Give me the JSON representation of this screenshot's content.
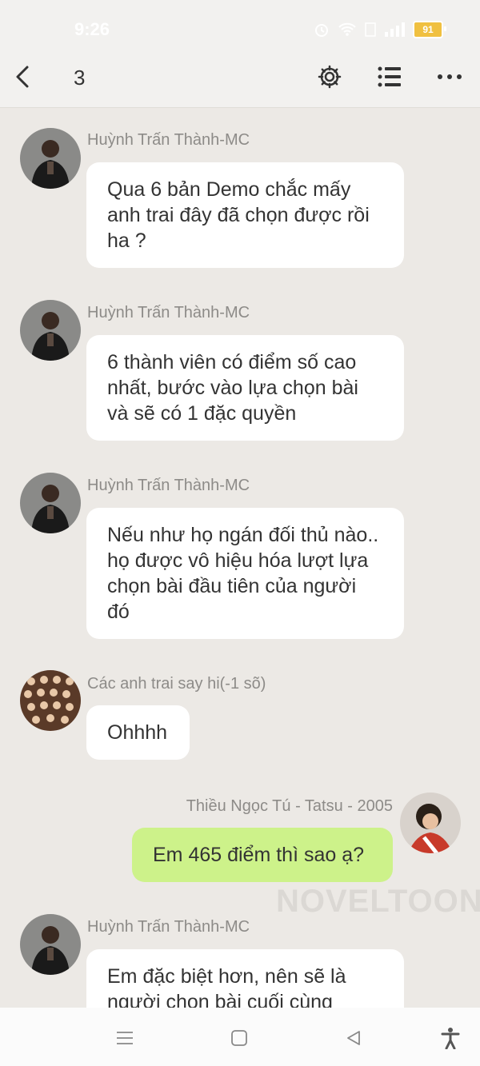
{
  "status_bar": {
    "time": "9:26",
    "battery": "91"
  },
  "header": {
    "title": "3"
  },
  "messages": [
    {
      "sender": "Huỳnh Trấn Thành-MC",
      "text": "Qua 6 bản Demo chắc mấy anh trai đây đã chọn được rồi ha ?"
    },
    {
      "sender": "Huỳnh Trấn Thành-MC",
      "text": "6 thành viên có điểm số cao nhất, bước vào lựa chọn bài và sẽ có 1 đặc quyền"
    },
    {
      "sender": "Huỳnh Trấn Thành-MC",
      "text": "Nếu như họ ngán đối thủ nào.. họ được vô hiệu hóa lượt lựa chọn bài đầu tiên của người đó"
    },
    {
      "sender": "Các anh trai say hi(-1 sõ)",
      "text": "Ohhhh"
    },
    {
      "sender": "Thiều Ngọc Tú - Tatsu - 2005",
      "text": "Em 465 điểm thì sao ạ?"
    },
    {
      "sender": "Huỳnh Trấn Thành-MC",
      "text": "Em đặc biệt hơn, nên sẽ là người chọn bài cuối cùng"
    }
  ],
  "watermark": "NOVELTOON",
  "colors": {
    "background": "#ece9e5",
    "own_bubble": "#cdf28a",
    "other_bubble": "#ffffff"
  }
}
